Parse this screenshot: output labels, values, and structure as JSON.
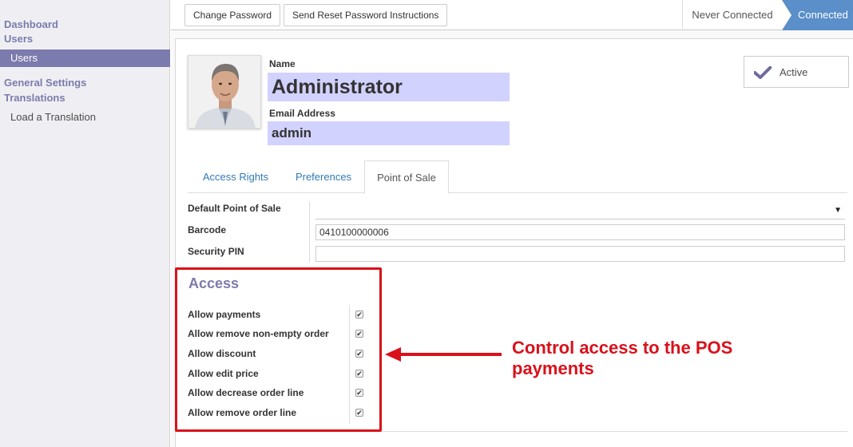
{
  "sidebar": {
    "dashboard": "Dashboard",
    "users_header": "Users",
    "users_item": "Users",
    "general_settings": "General Settings",
    "translations": "Translations",
    "load_translation": "Load a Translation"
  },
  "toolbar": {
    "change_password": "Change Password",
    "send_reset": "Send Reset Password Instructions"
  },
  "status": {
    "never_connected": "Never Connected",
    "connected": "Connected",
    "active_stage": "Connected"
  },
  "form": {
    "name_label": "Name",
    "name_value": "Administrator",
    "email_label": "Email Address",
    "email_value": "admin",
    "active_label": "Active"
  },
  "tabs": [
    "Access Rights",
    "Preferences",
    "Point of Sale"
  ],
  "active_tab": "Point of Sale",
  "fields": {
    "default_pos_label": "Default Point of Sale",
    "default_pos_value": "",
    "barcode_label": "Barcode",
    "barcode_value": "0410100000006",
    "security_pin_label": "Security PIN",
    "security_pin_value": ""
  },
  "access": {
    "title": "Access",
    "items": [
      {
        "label": "Allow payments",
        "checked": true
      },
      {
        "label": "Allow remove non-empty order",
        "checked": true
      },
      {
        "label": "Allow discount",
        "checked": true
      },
      {
        "label": "Allow edit price",
        "checked": true
      },
      {
        "label": "Allow decrease order line",
        "checked": true
      },
      {
        "label": "Allow remove order line",
        "checked": true
      }
    ]
  },
  "annotation": {
    "text": "Control access to the POS payments",
    "color": "#d9111b"
  },
  "colors": {
    "accent": "#7c7bad",
    "stage_active": "#5a8fc9",
    "required_field": "#d2d2ff",
    "link": "#337ab7"
  }
}
